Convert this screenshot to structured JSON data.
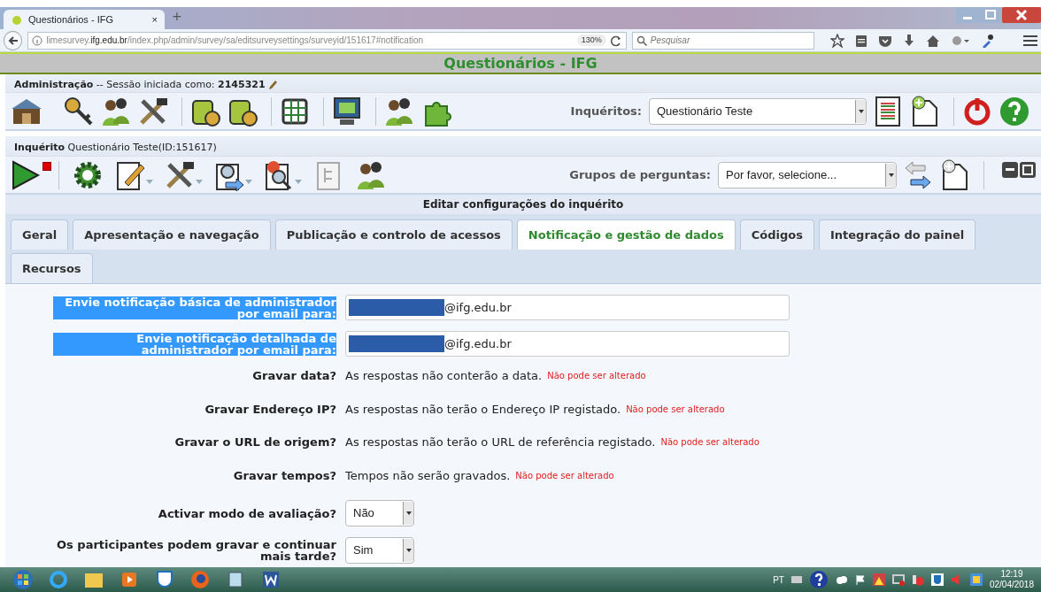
{
  "browser": {
    "tab_title": "Questionários - IFG",
    "tab_close": "×",
    "new_tab": "+",
    "url_host_pre": "limesurvey.",
    "url_host": "ifg.edu.br",
    "url_path": "/index.php/admin/survey/sa/editsurveysettings/surveyid/151617#notification",
    "zoom": "130%",
    "search_placeholder": "Pesquisar"
  },
  "header": {
    "title": "Questionários - IFG"
  },
  "admin_bar": {
    "label": "Administração",
    "text": "-- Sessão iniciada como:",
    "user": "2145321"
  },
  "surveys": {
    "label": "Inquéritos:",
    "value": "Questionário Teste"
  },
  "survey_bar": {
    "label": "Inquérito",
    "text": "Questionário Teste(ID:151617)"
  },
  "groups": {
    "label": "Grupos de perguntas:",
    "value": "Por favor, selecione..."
  },
  "section_title": "Editar configurações do inquérito",
  "tabs": [
    {
      "label": "Geral",
      "selected": false
    },
    {
      "label": "Apresentação e navegação",
      "selected": false
    },
    {
      "label": "Publicação e controlo de acessos",
      "selected": false
    },
    {
      "label": "Notificação e gestão de dados",
      "selected": true
    },
    {
      "label": "Códigos",
      "selected": false
    },
    {
      "label": "Integração do painel",
      "selected": false
    },
    {
      "label": "Recursos",
      "selected": false
    }
  ],
  "fields": [
    {
      "kind": "email",
      "label": "Envie notificação básica de administrador por email para:",
      "highlighted": true,
      "value": "@ifg.edu.br"
    },
    {
      "kind": "email",
      "label": "Envie notificação detalhada de administrador por email para:",
      "highlighted": true,
      "value": "@ifg.edu.br"
    },
    {
      "kind": "text",
      "label": "Gravar data?",
      "highlighted": false,
      "value": "As respostas não conterão a data.",
      "note": "Não pode ser alterado"
    },
    {
      "kind": "text",
      "label": "Gravar Endereço IP?",
      "highlighted": false,
      "value": "As respostas não terão o Endereço IP registado.",
      "note": "Não pode ser alterado"
    },
    {
      "kind": "text",
      "label": "Gravar o URL de origem?",
      "highlighted": false,
      "value": "As respostas não terão o URL de referência registado.",
      "note": "Não pode ser alterado"
    },
    {
      "kind": "text",
      "label": "Gravar tempos?",
      "highlighted": false,
      "value": "Tempos não serão gravados.",
      "note": "Não pode ser alterado"
    },
    {
      "kind": "select",
      "label": "Activar modo de avaliação?",
      "highlighted": false,
      "value": "Não"
    },
    {
      "kind": "select",
      "label": "Os participantes podem gravar e continuar mais tarde?",
      "highlighted": false,
      "value": "Sim"
    }
  ],
  "taskbar": {
    "lang": "PT",
    "time": "12:19",
    "date": "02/04/2018"
  }
}
